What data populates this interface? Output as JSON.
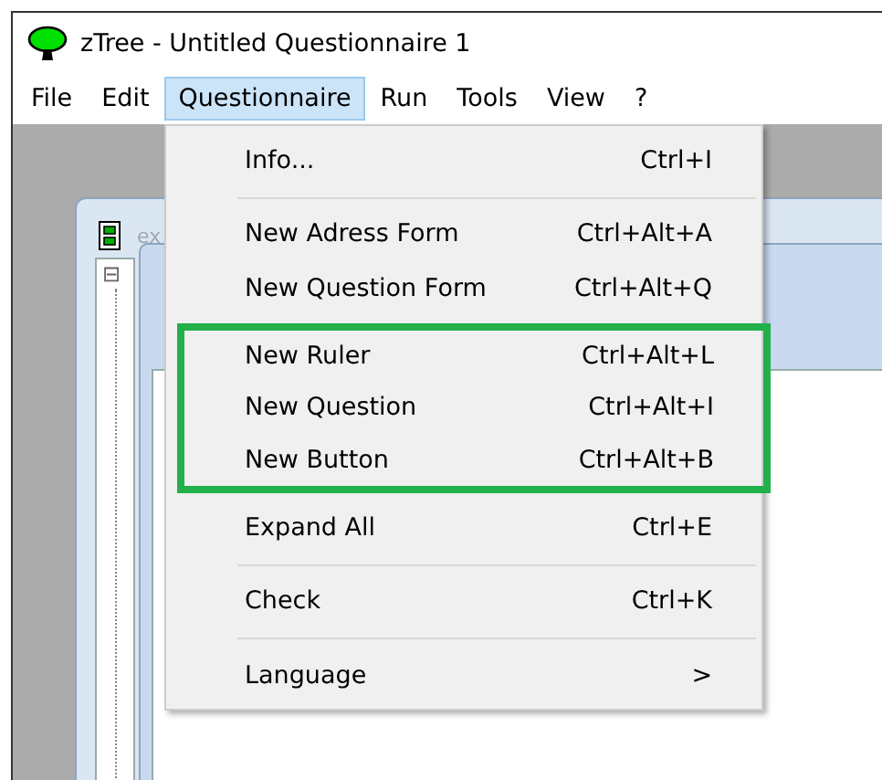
{
  "window": {
    "title": "zTree - Untitled Questionnaire 1"
  },
  "menubar": [
    {
      "label": "File",
      "selected": false
    },
    {
      "label": "Edit",
      "selected": false
    },
    {
      "label": "Questionnaire",
      "selected": true
    },
    {
      "label": "Run",
      "selected": false
    },
    {
      "label": "Tools",
      "selected": false
    },
    {
      "label": "View",
      "selected": false
    },
    {
      "label": "?",
      "selected": false
    }
  ],
  "child_window": {
    "title": "ex",
    "tree_toggle": "⊟"
  },
  "menu": [
    {
      "kind": "item",
      "label": "Info...",
      "shortcut": "Ctrl+I"
    },
    {
      "kind": "separator"
    },
    {
      "kind": "item",
      "label": "New Adress Form",
      "shortcut": "Ctrl+Alt+A"
    },
    {
      "kind": "item",
      "label": "New Question Form",
      "shortcut": "Ctrl+Alt+Q"
    },
    {
      "kind": "highlight",
      "items": [
        {
          "kind": "item",
          "label": "New Ruler",
          "shortcut": "Ctrl+Alt+L"
        },
        {
          "kind": "item",
          "label": "New Question",
          "shortcut": "Ctrl+Alt+I"
        },
        {
          "kind": "item",
          "label": "New Button",
          "shortcut": "Ctrl+Alt+B"
        }
      ]
    },
    {
      "kind": "item",
      "label": "Expand All",
      "shortcut": "Ctrl+E"
    },
    {
      "kind": "separator"
    },
    {
      "kind": "item",
      "label": "Check",
      "shortcut": "Ctrl+K"
    },
    {
      "kind": "separator"
    },
    {
      "kind": "submenu",
      "label": "Language",
      "arrow": ">"
    }
  ]
}
